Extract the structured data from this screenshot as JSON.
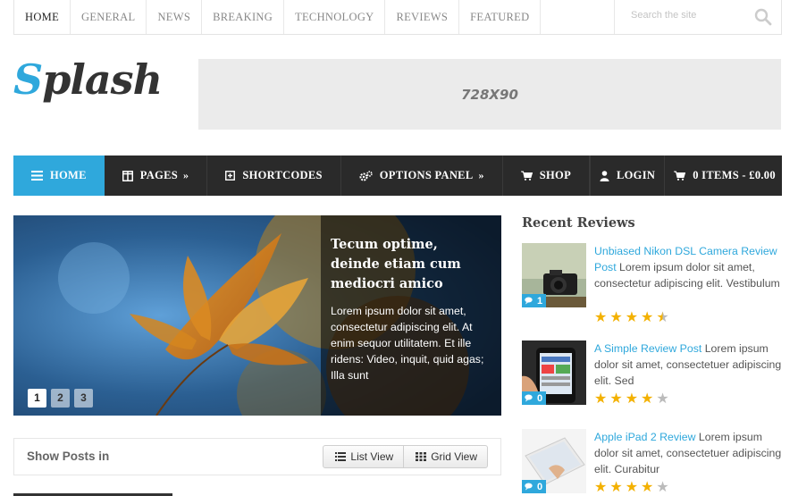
{
  "topnav": {
    "items": [
      "Home",
      "General",
      "News",
      "Breaking",
      "Technology",
      "Reviews",
      "Featured"
    ],
    "search_placeholder": "Search the site"
  },
  "logo": {
    "first": "S",
    "rest": "plash"
  },
  "ad": {
    "label": "728X90"
  },
  "mainnav": {
    "items": [
      {
        "label": "Home",
        "icon": "menu-icon",
        "has_submenu": false
      },
      {
        "label": "Pages",
        "icon": "columns-icon",
        "has_submenu": true
      },
      {
        "label": "Shortcodes",
        "icon": "plus-square-icon",
        "has_submenu": false
      },
      {
        "label": "Options Panel",
        "icon": "gears-icon",
        "has_submenu": true
      },
      {
        "label": "Shop",
        "icon": "cart-icon",
        "has_submenu": false
      }
    ],
    "login_label": "Login",
    "cart_label": "0 Items - £0.00",
    "submenu_arrow": "»"
  },
  "slider": {
    "title": "Tecum optime, deinde etiam cum mediocri amico",
    "excerpt": "Lorem ipsum dolor sit amet, consectetur adipiscing elit. At enim sequor utilitatem. Et ille ridens: Video, inquit, quid agas; Illa sunt",
    "pages": [
      "1",
      "2",
      "3"
    ],
    "active_page": "1"
  },
  "showposts": {
    "label": "Show Posts in",
    "list_view": "List View",
    "grid_view": "Grid View"
  },
  "sidebar": {
    "title": "Recent Reviews",
    "reviews": [
      {
        "link": "Unbiased Nikon DSL Camera Review Post",
        "text": " Lorem ipsum dolor sit amet, consectetur adipiscing elit. Vestibulum",
        "comments": "1",
        "rating": 4.5
      },
      {
        "link": "A Simple Review Post",
        "text": " Lorem ipsum dolor sit amet, consectetuer adipiscing elit. Sed",
        "comments": "0",
        "rating": 4
      },
      {
        "link": "Apple iPad 2 Review",
        "text": " Lorem ipsum dolor sit amet, consectetuer adipiscing elit. Curabitur",
        "comments": "0",
        "rating": 4
      }
    ]
  },
  "colors": {
    "accent": "#2fa8dc",
    "nav_bg": "#2a2a2a",
    "star": "#f3b100"
  }
}
